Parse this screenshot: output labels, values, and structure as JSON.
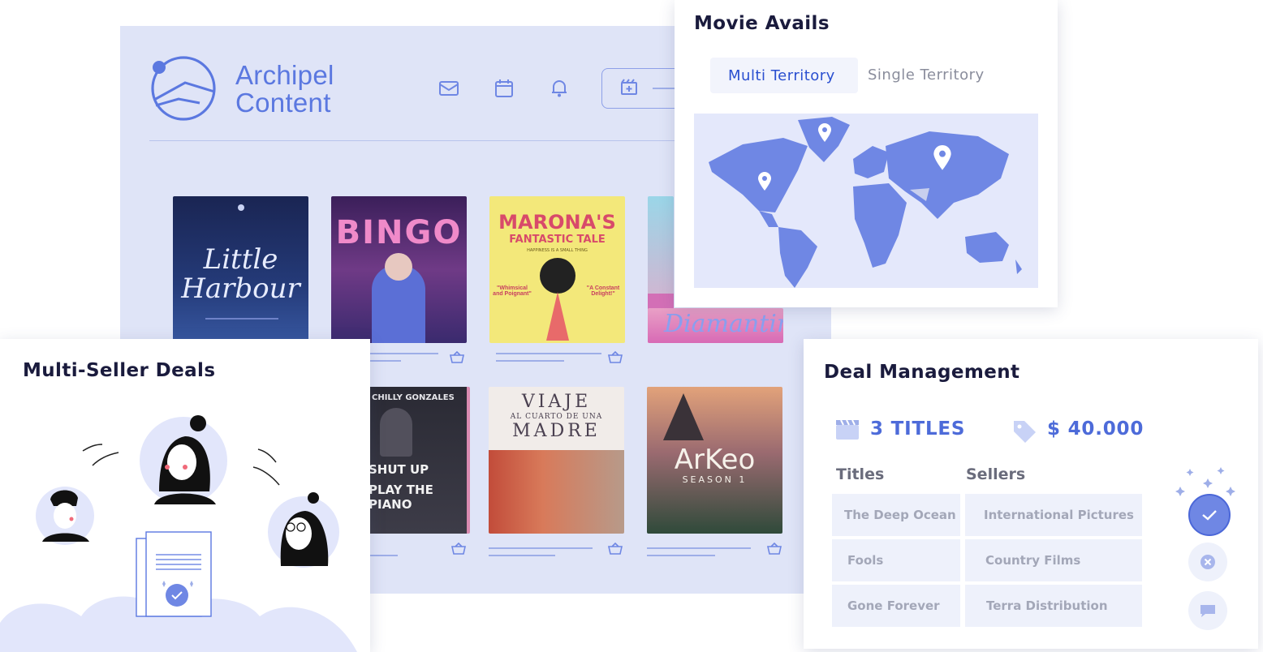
{
  "app": {
    "brand_line1": "Archipel",
    "brand_line2": "Content",
    "icons": [
      "mail-icon",
      "calendar-icon",
      "bell-icon",
      "film-add-icon"
    ],
    "accent": "#5b78e0",
    "panel_bg": "#dfe4f7"
  },
  "posters": [
    {
      "title": "Little Harbour",
      "style": "dark-blue"
    },
    {
      "title": "BINGO",
      "style": "magenta"
    },
    {
      "title": "MARONA'S",
      "subtitle": "FANTASTIC TALE",
      "tagline": "HAPPINESS IS A SMALL THING",
      "quote_left": "\"Whimsical and Poignant\"",
      "quote_right": "\"A Constant Delight!\"",
      "style": "yellow"
    },
    {
      "title": "Diamantino",
      "style": "pink"
    },
    {
      "title": "SHUT UP",
      "subtitle": "PLAY THE PIANO",
      "top": "CHILLY GONZALES",
      "style": "dark"
    },
    {
      "title": "VIAJE",
      "subtitle": "AL CUARTO DE UNA",
      "title2": "MADRE",
      "style": "light"
    },
    {
      "title": "ArKeo",
      "subtitle": "SEASON 1",
      "style": "sunset"
    }
  ],
  "movie_avails": {
    "title": "Movie Avails",
    "tabs": [
      "Multi Territory",
      "Single Territory"
    ],
    "active_tab": "Multi Territory",
    "map_icons": [
      "map-pin-icon",
      "map-pin-icon",
      "map-pin-icon"
    ]
  },
  "multi_seller": {
    "title": "Multi-Seller Deals"
  },
  "deal_management": {
    "title": "Deal Management",
    "titles_count": "3 TITLES",
    "amount": "$ 40.000",
    "col_titles": "Titles",
    "col_sellers": "Sellers",
    "rows": [
      {
        "title": "The Deep Ocean",
        "seller": "International Pictures"
      },
      {
        "title": "Fools",
        "seller": "Country Films"
      },
      {
        "title": "Gone Forever",
        "seller": "Terra Distribution"
      }
    ],
    "actions": [
      "check-icon",
      "close-icon",
      "chat-icon"
    ]
  }
}
